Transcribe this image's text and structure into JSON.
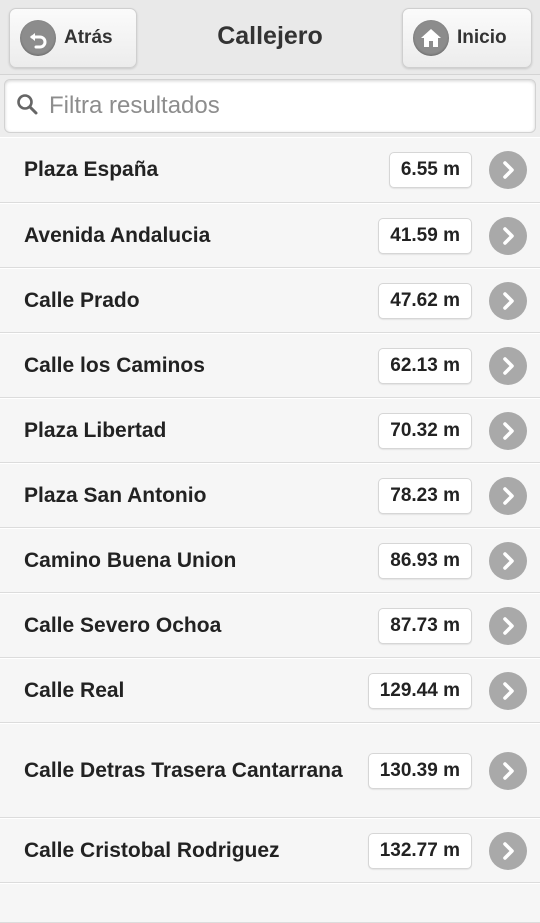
{
  "header": {
    "back_label": "Atrás",
    "title": "Callejero",
    "home_label": "Inicio"
  },
  "search": {
    "placeholder": "Filtra resultados",
    "value": ""
  },
  "items": [
    {
      "name": "Plaza España",
      "distance": "6.55 m"
    },
    {
      "name": "Avenida Andalucia",
      "distance": "41.59 m"
    },
    {
      "name": "Calle Prado",
      "distance": "47.62 m"
    },
    {
      "name": "Calle los Caminos",
      "distance": "62.13 m"
    },
    {
      "name": "Plaza Libertad",
      "distance": "70.32 m"
    },
    {
      "name": "Plaza San Antonio",
      "distance": "78.23 m"
    },
    {
      "name": "Camino Buena Union",
      "distance": "86.93 m"
    },
    {
      "name": "Calle Severo Ochoa",
      "distance": "87.73 m"
    },
    {
      "name": "Calle Real",
      "distance": "129.44 m"
    },
    {
      "name": "Calle Detras Trasera Cantarrana",
      "distance": "130.39 m"
    },
    {
      "name": "Calle Cristobal Rodriguez",
      "distance": "132.77 m"
    },
    {
      "name": "",
      "distance": ""
    }
  ],
  "icons": {
    "back": "arrow-back-icon",
    "home": "home-icon",
    "search": "search-icon",
    "row_arrow": "chevron-right-icon"
  }
}
